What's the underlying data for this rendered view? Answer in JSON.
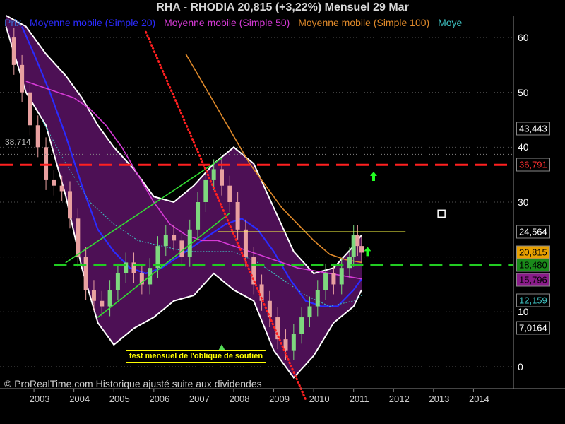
{
  "header": {
    "title": "RHA - RHODIA     20,815 (+3,22%)    Mensuel  29 Mar"
  },
  "legend": [
    {
      "label": "Prix",
      "color": "#3a6acc"
    },
    {
      "label": "Moyenne mobile (Simple 20)",
      "color": "#2b2bff"
    },
    {
      "label": "Moyenne mobile (Simple 50)",
      "color": "#d63ad6"
    },
    {
      "label": "Moyenne mobile (Simple 100)",
      "color": "#e08a2a"
    },
    {
      "label": "Moye",
      "color": "#3fc4c4"
    }
  ],
  "footer": {
    "text": "© ProRealTime.com Historique ajusté suite aux dividendes"
  },
  "annotation": {
    "text": "test mensuel de l'oblique de soutien"
  },
  "h_level_label": "38,714",
  "chart_data": {
    "type": "line",
    "title": "RHA - RHODIA     20,815 (+3,22%)    Mensuel  29 Mar",
    "xlabel": "",
    "ylabel": "",
    "x_ticks": [
      "2003",
      "2004",
      "2005",
      "2006",
      "2007",
      "2008",
      "2009",
      "2010",
      "2011",
      "2012",
      "2013",
      "2014"
    ],
    "y_ticks": [
      0,
      10,
      20,
      30,
      40,
      50,
      60
    ],
    "y_tick_labels": [
      "0",
      "10",
      "20",
      "30",
      "40",
      "50",
      "60"
    ],
    "ylim": [
      -4,
      64
    ],
    "xlim": [
      2002.15,
      2015.0
    ],
    "price": {
      "x": [
        2002.3,
        2002.5,
        2002.7,
        2002.9,
        2003.1,
        2003.3,
        2003.5,
        2003.7,
        2003.9,
        2004.1,
        2004.3,
        2004.5,
        2004.7,
        2004.9,
        2005.1,
        2005.3,
        2005.5,
        2005.7,
        2005.9,
        2006.1,
        2006.3,
        2006.5,
        2006.7,
        2006.9,
        2007.1,
        2007.3,
        2007.5,
        2007.7,
        2007.9,
        2008.1,
        2008.3,
        2008.5,
        2008.7,
        2008.9,
        2009.1,
        2009.3,
        2009.5,
        2009.7,
        2009.9,
        2010.1,
        2010.3,
        2010.5,
        2010.7,
        2010.9,
        2011.0,
        2011.1,
        2011.2
      ],
      "y": [
        60,
        55,
        50,
        44,
        40,
        34,
        33,
        32,
        27,
        20,
        14,
        12,
        11,
        14,
        17,
        19,
        17,
        15,
        18,
        22,
        24,
        23,
        20,
        25,
        30,
        34,
        36,
        33,
        30,
        25,
        20,
        15,
        12,
        9,
        5,
        3,
        6,
        9,
        11,
        14,
        17,
        15,
        18,
        20,
        24,
        22,
        20.8
      ]
    },
    "bands": {
      "x": [
        2002.3,
        2002.8,
        2003.3,
        2003.8,
        2004.2,
        2004.6,
        2005.0,
        2005.5,
        2006.0,
        2006.5,
        2007.0,
        2007.5,
        2008.0,
        2008.5,
        2009.0,
        2009.5,
        2010.0,
        2010.5,
        2011.0,
        2011.2
      ],
      "upper": [
        64,
        62,
        57,
        53,
        49,
        44,
        40,
        36,
        31,
        30,
        33,
        37,
        40,
        37,
        29,
        21,
        17,
        18,
        22,
        24
      ],
      "lower": [
        62,
        50,
        44,
        31,
        18,
        8,
        4,
        7,
        9,
        12,
        13,
        17,
        14,
        12,
        3,
        -2,
        2,
        8,
        11,
        14
      ]
    },
    "ma_series": [
      {
        "name": "Moyenne mobile (Simple 20)",
        "color": "#2b2bff",
        "x": [
          2002.7,
          2003.0,
          2003.4,
          2003.8,
          2004.2,
          2004.6,
          2005.0,
          2005.4,
          2005.8,
          2006.2,
          2006.6,
          2007.0,
          2007.4,
          2007.8,
          2008.2,
          2008.6,
          2009.0,
          2009.4,
          2009.8,
          2010.2,
          2010.6,
          2011.0,
          2011.2
        ],
        "y": [
          62,
          57,
          50,
          42,
          33,
          25,
          21,
          18,
          17,
          18,
          20,
          22,
          24,
          26,
          27,
          25,
          21,
          16,
          12,
          11,
          11,
          14,
          16
        ]
      },
      {
        "name": "Moyenne mobile (Simple 50)",
        "color": "#d63ad6",
        "x": [
          2002.8,
          2003.2,
          2003.6,
          2004.0,
          2004.4,
          2004.8,
          2005.2,
          2005.6,
          2006.0,
          2006.4,
          2006.8,
          2007.2,
          2007.6,
          2008.0,
          2008.4,
          2008.8,
          2009.2,
          2009.6,
          2010.0,
          2010.4,
          2010.8,
          2011.2
        ],
        "y": [
          52,
          51,
          50,
          49,
          47,
          44,
          40,
          35,
          30,
          26,
          24,
          23,
          23,
          22,
          21,
          20,
          19,
          18,
          17.5,
          17,
          16.5,
          16
        ]
      },
      {
        "name": "Moyenne mobile (Simple 100)",
        "color": "#e08a2a",
        "x": [
          2006.8,
          2007.2,
          2007.6,
          2008.0,
          2008.4,
          2008.8,
          2009.2,
          2009.6,
          2010.0,
          2010.4,
          2010.8,
          2011.2
        ],
        "y": [
          57,
          52,
          47,
          42,
          37,
          33,
          29,
          26,
          23,
          20.5,
          19.5,
          19
        ]
      },
      {
        "name": "Moye",
        "color": "#3fc4c4",
        "x": [
          2003.2,
          2003.8,
          2004.4,
          2005.0,
          2005.6,
          2006.2,
          2006.8,
          2007.4,
          2008.0,
          2008.6,
          2009.2,
          2009.8,
          2010.4,
          2011.0,
          2011.2
        ],
        "y": [
          45,
          37,
          30,
          26,
          23,
          22,
          21,
          21,
          21,
          19,
          16,
          13,
          11,
          12,
          13
        ]
      }
    ],
    "horizontal_levels": [
      {
        "y": 36.791,
        "color": "#ff2020",
        "style": "dashed",
        "x_from": 2002.15
      },
      {
        "y": 18.48,
        "color": "#22cc22",
        "style": "dashed",
        "x_from": 2003.5
      },
      {
        "y": 24.564,
        "color": "#ffff44",
        "style": "solid",
        "x_from": 2007.6,
        "x_to": 2012.3
      },
      {
        "y": 38.714,
        "color": "#888888",
        "style": "dotted",
        "x_from": 2002.15
      }
    ],
    "trendlines": [
      {
        "color": "#33dd33",
        "x": [
          2004.6,
          2007.9
        ],
        "y": [
          9,
          28
        ]
      },
      {
        "color": "#33dd33",
        "x": [
          2003.8,
          2007.7
        ],
        "y": [
          19,
          38
        ]
      },
      {
        "color": "#ff2020",
        "style": "dotted",
        "x": [
          2005.8,
          2009.8
        ],
        "y": [
          61,
          -6
        ]
      }
    ],
    "markers": [
      {
        "shape": "arrow-up",
        "color": "#22ff22",
        "x": 2011.5,
        "y": 34.5
      },
      {
        "shape": "arrow-up",
        "color": "#22ff22",
        "x": 2011.35,
        "y": 20.8
      },
      {
        "shape": "triangle-up",
        "color": "#55dd55",
        "x": 2007.7,
        "y": 3.2
      },
      {
        "shape": "square",
        "color": "#ffffff",
        "x": 2013.2,
        "y": 27.9
      }
    ],
    "price_labels": [
      {
        "text": "43,443",
        "y": 43.443,
        "bg": "#000000",
        "fg": "#ffffff"
      },
      {
        "text": "36,791",
        "y": 36.791,
        "bg": "#000000",
        "fg": "#ff3030"
      },
      {
        "text": "24,564",
        "y": 24.564,
        "bg": "#000000",
        "fg": "#ffffff"
      },
      {
        "text": "20,815",
        "y": 20.815,
        "bg": "#e8a000",
        "fg": "#000000"
      },
      {
        "text": "18,480",
        "y": 18.48,
        "bg": "#1a8a1a",
        "fg": "#000000"
      },
      {
        "text": "15,796",
        "y": 15.796,
        "bg": "#8a1c8a",
        "fg": "#000000"
      },
      {
        "text": "12,159",
        "y": 12.159,
        "bg": "#000000",
        "fg": "#3fc4c4"
      },
      {
        "text": "7,0164",
        "y": 7.0164,
        "bg": "#000000",
        "fg": "#ffffff"
      }
    ]
  }
}
